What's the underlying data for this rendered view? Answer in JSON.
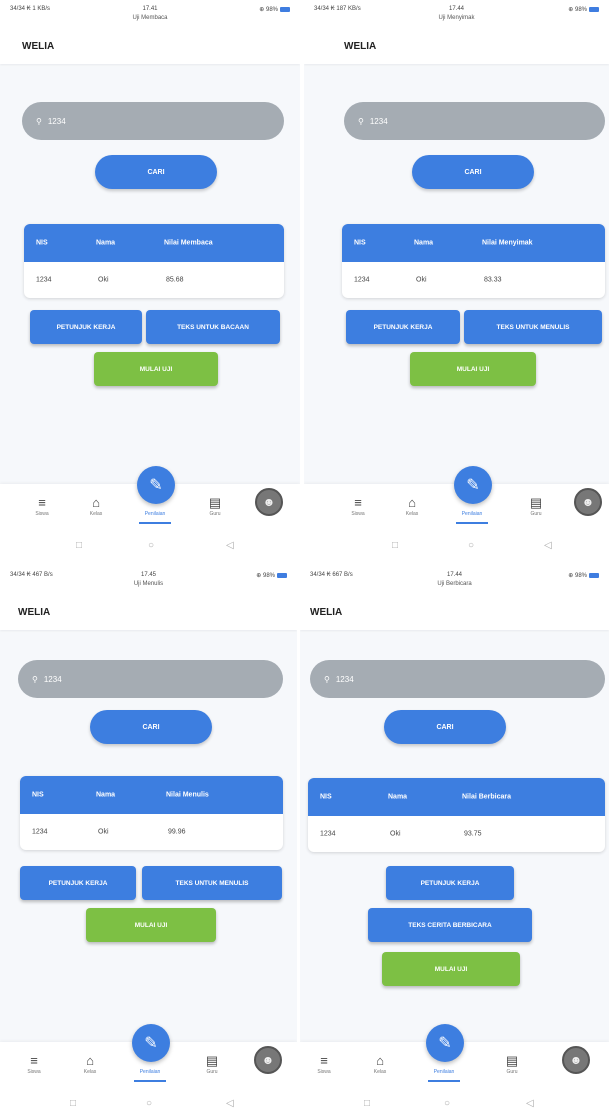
{
  "screens": [
    {
      "status": {
        "left": "34/34 ₭ 1 KB/s",
        "time": "17.41",
        "title": "Uji Membaca",
        "right": "⊕ 98%"
      },
      "app_title": "WELIA",
      "search": {
        "value": "1234"
      },
      "cari_label": "CARI",
      "table": {
        "headers": [
          "NIS",
          "Nama",
          "Nilai Membaca"
        ],
        "row": [
          "1234",
          "Oki",
          "85.68"
        ]
      },
      "buttons": {
        "petunjuk": "PETUNJUK KERJA",
        "teks": "TEKS UNTUK BACAAN",
        "mulai": "MULAI UJI"
      }
    },
    {
      "status": {
        "left": "34/34 ₭ 187 KB/s",
        "time": "17.44",
        "title": "Uji Menyimak",
        "right": "⊕ 98%"
      },
      "app_title": "WELIA",
      "search": {
        "value": "1234"
      },
      "cari_label": "CARI",
      "table": {
        "headers": [
          "NIS",
          "Nama",
          "Nilai Menyimak"
        ],
        "row": [
          "1234",
          "Oki",
          "83.33"
        ]
      },
      "buttons": {
        "petunjuk": "PETUNJUK KERJA",
        "teks": "TEKS UNTUK MENULIS",
        "mulai": "MULAI UJI"
      }
    },
    {
      "status": {
        "left": "34/34 ₭ 467 B/s",
        "time": "17.45",
        "title": "Uji Menulis",
        "right": "⊕ 98%"
      },
      "app_title": "WELIA",
      "search": {
        "value": "1234"
      },
      "cari_label": "CARI",
      "table": {
        "headers": [
          "NIS",
          "Nama",
          "Nilai Menulis"
        ],
        "row": [
          "1234",
          "Oki",
          "99.96"
        ]
      },
      "buttons": {
        "petunjuk": "PETUNJUK KERJA",
        "teks": "TEKS UNTUK MENULIS",
        "mulai": "MULAI UJI"
      }
    },
    {
      "status": {
        "left": "34/34 ₭ 667 B/s",
        "time": "17.44",
        "title": "Uji Berbicara",
        "right": "⊕ 98%"
      },
      "app_title": "WELIA",
      "search": {
        "value": "1234"
      },
      "cari_label": "CARI",
      "table": {
        "headers": [
          "NIS",
          "Nama",
          "Nilai Berbicara"
        ],
        "row": [
          "1234",
          "Oki",
          "93.75"
        ]
      },
      "buttons": {
        "petunjuk": "PETUNJUK KERJA",
        "teks": "TEKS CERITA BERBICARA",
        "mulai": "MULAI UJI"
      }
    }
  ],
  "bottom_nav": {
    "items": [
      "Siswa",
      "Kelas",
      "Penilaian",
      "Guru"
    ],
    "active": "Penilaian"
  },
  "icons": {
    "search": "search-icon",
    "siswa": "layers-icon",
    "kelas": "home-icon",
    "penilaian": "pencil-icon",
    "guru": "id-card-icon",
    "profile": "avatar-icon"
  },
  "colors": {
    "primary": "#3d7ee0",
    "success": "#7dc044",
    "search_bg": "#a5acb3"
  }
}
